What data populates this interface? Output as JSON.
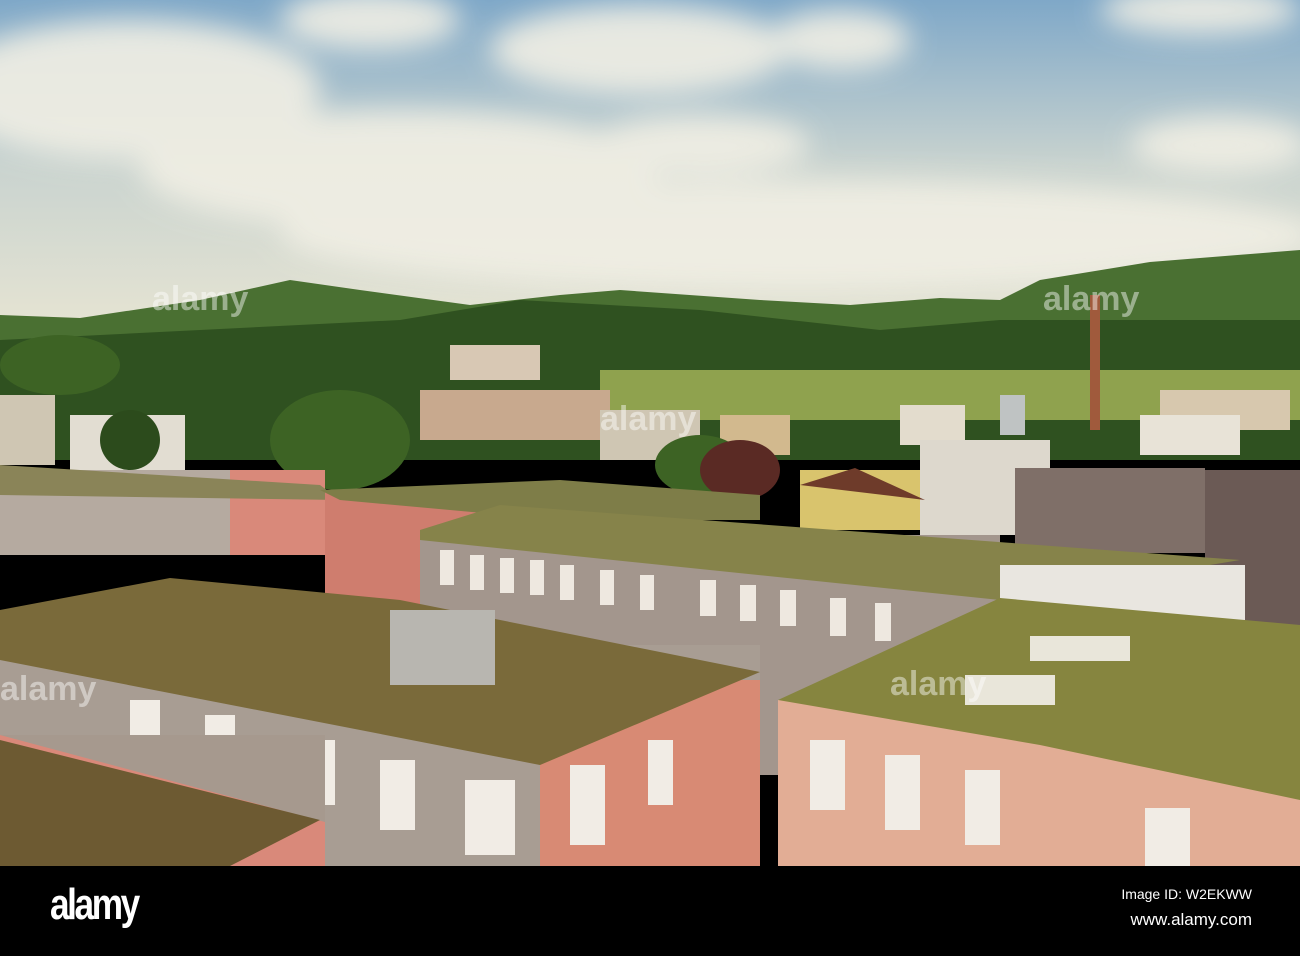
{
  "watermark": {
    "logo_text": "alamy"
  },
  "footer": {
    "logo": "alamy",
    "image_id": "Image ID: W2EKWW",
    "website": "www.alamy.com"
  },
  "colors": {
    "sky": "#8fb4cf",
    "hills": "#3f6a2a",
    "roof_green": "#7d7a45",
    "facade_pink": "#d98a72",
    "facade_grey": "#a59a90"
  }
}
